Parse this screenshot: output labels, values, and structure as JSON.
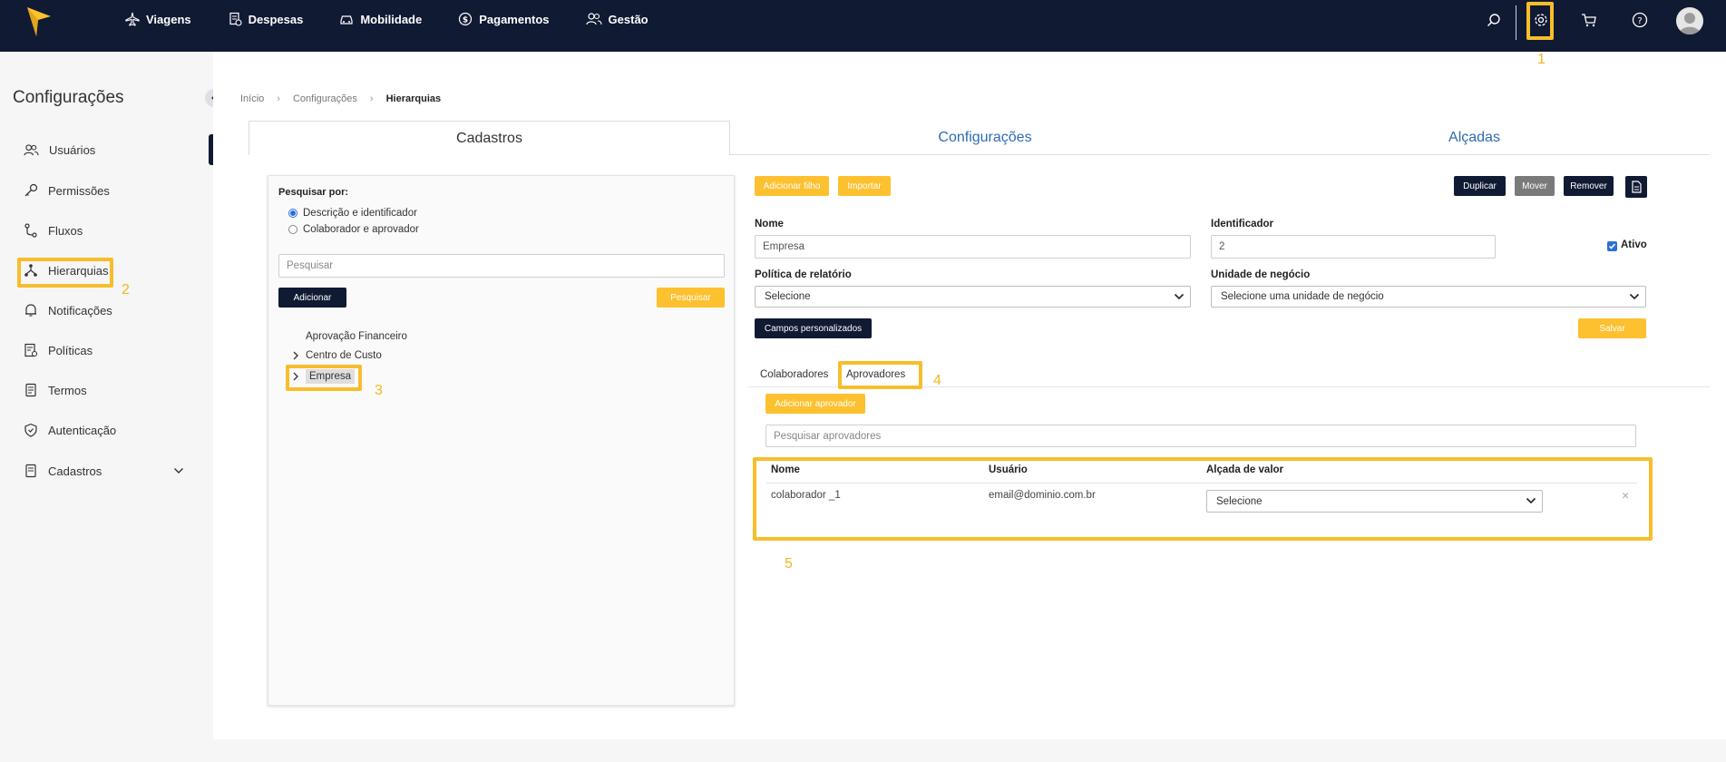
{
  "topbar": {
    "nav": [
      {
        "label": "Viagens",
        "icon": "airplane-icon"
      },
      {
        "label": "Despesas",
        "icon": "receipt-icon"
      },
      {
        "label": "Mobilidade",
        "icon": "car-icon"
      },
      {
        "label": "Pagamentos",
        "icon": "dollar-icon"
      },
      {
        "label": "Gestão",
        "icon": "users-icon"
      }
    ],
    "icons": [
      "search-icon",
      "gear-icon",
      "cart-icon",
      "help-icon",
      "avatar-icon"
    ]
  },
  "annotations": {
    "n1": "1",
    "n2": "2",
    "n3": "3",
    "n4": "4",
    "n5": "5",
    "color": "#f7be2c"
  },
  "sidebar": {
    "title": "Configurações",
    "items": [
      {
        "label": "Usuários",
        "icon": "users-icon"
      },
      {
        "label": "Permissões",
        "icon": "key-icon"
      },
      {
        "label": "Fluxos",
        "icon": "flow-icon"
      },
      {
        "label": "Hierarquias",
        "icon": "hierarchy-icon"
      },
      {
        "label": "Notificações",
        "icon": "bell-icon"
      },
      {
        "label": "Políticas",
        "icon": "policy-icon"
      },
      {
        "label": "Termos",
        "icon": "document-icon"
      },
      {
        "label": "Autenticação",
        "icon": "shield-icon"
      },
      {
        "label": "Cadastros",
        "icon": "folder-icon"
      }
    ]
  },
  "breadcrumb": [
    "Início",
    "Configurações",
    "Hierarquias"
  ],
  "tabs": [
    "Cadastros",
    "Configurações",
    "Alçadas"
  ],
  "search_panel": {
    "title": "Pesquisar por:",
    "options": [
      "Descrição e identificador",
      "Colaborador e aprovador"
    ],
    "selected_option": "Descrição e identificador",
    "placeholder": "Pesquisar",
    "add_label": "Adicionar",
    "search_label": "Pesquisar",
    "tree": [
      "Aprovação Financeiro",
      "Centro de Custo",
      "Empresa"
    ]
  },
  "detail": {
    "add_child_label": "Adicionar filho",
    "import_label": "Importar",
    "duplicate_label": "Duplicar",
    "move_label": "Mover",
    "remove_label": "Remover",
    "name_label": "Nome",
    "name_value": "Empresa",
    "identifier_label": "Identificador",
    "identifier_value": "2",
    "active_label": "Ativo",
    "active_checked": true,
    "report_policy_label": "Política de relatório",
    "report_policy_value": "Selecione",
    "business_unit_label": "Unidade de negócio",
    "business_unit_value": "Selecione uma unidade de negócio",
    "custom_fields_label": "Campos personalizados",
    "save_label": "Salvar",
    "sub_tabs": [
      "Colaboradores",
      "Aprovadores"
    ],
    "add_approver_label": "Adicionar aprovador",
    "approver_search_placeholder": "Pesquisar aprovadores",
    "table": {
      "headers": [
        "Nome",
        "Usuário",
        "Alçada de valor"
      ],
      "rows": [
        {
          "name": "colaborador _1",
          "user": "email@dominio.com.br",
          "limit": "Selecione"
        }
      ]
    }
  },
  "colors": {
    "navy": "#111a33",
    "yellow": "#fdc02f",
    "link_blue": "#2d6bb4"
  }
}
